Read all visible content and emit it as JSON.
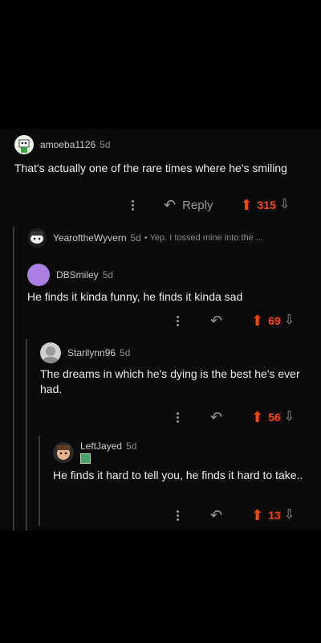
{
  "comments": [
    {
      "username": "amoeba1126",
      "age": "5d",
      "body": "That's actually one of the rare times where he's smiling",
      "reply_label": "Reply",
      "score": "315"
    },
    {
      "username": "YearoftheWyvern",
      "age": "5d",
      "preview": "• Yep. I tossed mine into the ..."
    },
    {
      "username": "DBSmiley",
      "age": "5d",
      "body": "He finds it kinda funny, he finds it kinda sad",
      "score": "69"
    },
    {
      "username": "Starilynn96",
      "age": "5d",
      "body": "The dreams in which he's dying is the best he's ever had.",
      "score": "56"
    },
    {
      "username": "LeftJayed",
      "age": "5d",
      "body": "He finds it hard to tell you, he finds it hard to take..",
      "score": "13"
    }
  ],
  "icons": {
    "reply": "reply-arrow-icon",
    "upvote": "upvote-arrow-icon",
    "downvote": "downvote-arrow-icon",
    "more": "more-options-icon"
  },
  "colors": {
    "upvote": "#ff4500",
    "background": "#0a0a0a",
    "avatar_purple": "#a97fe0"
  }
}
